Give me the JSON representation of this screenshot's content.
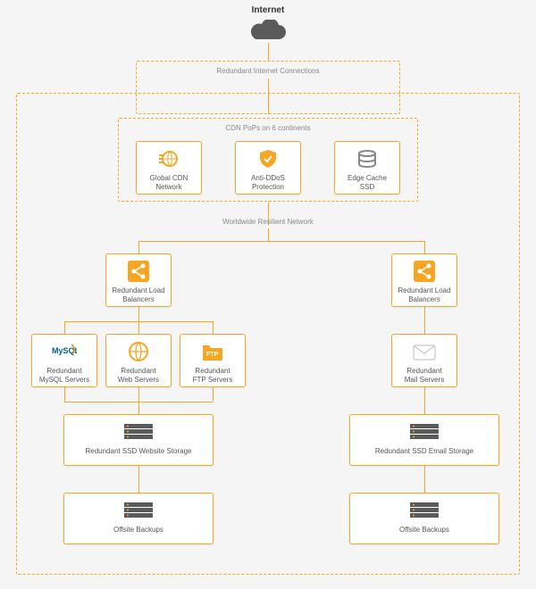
{
  "title": "Internet",
  "region_connections": "Redundant Internet Connections",
  "region_cdn": "CDN PoPs on 6 continents",
  "region_network": "Worldwide Resilient Network",
  "cdn": {
    "global": {
      "label": "Global CDN\nNetwork"
    },
    "ddos": {
      "label": "Anti-DDoS\nProtection"
    },
    "edge": {
      "label": "Edge Cache\nSSD"
    }
  },
  "left": {
    "lb": "Redundant Load\nBalancers",
    "mysql": "Redundant\nMySQL Servers",
    "web": "Redundant\nWeb Servers",
    "ftp": "Redundant\nFTP Servers",
    "storage": "Redundant SSD Website Storage",
    "backup": "Offsite Backups"
  },
  "right": {
    "lb": "Redundant Load\nBalancers",
    "mail": "Redundant\nMail Servers",
    "storage": "Redundant SSD Email Storage",
    "backup": "Offsite Backups"
  },
  "colors": {
    "accent": "#f5a623",
    "cloud": "#5a5a5a"
  }
}
